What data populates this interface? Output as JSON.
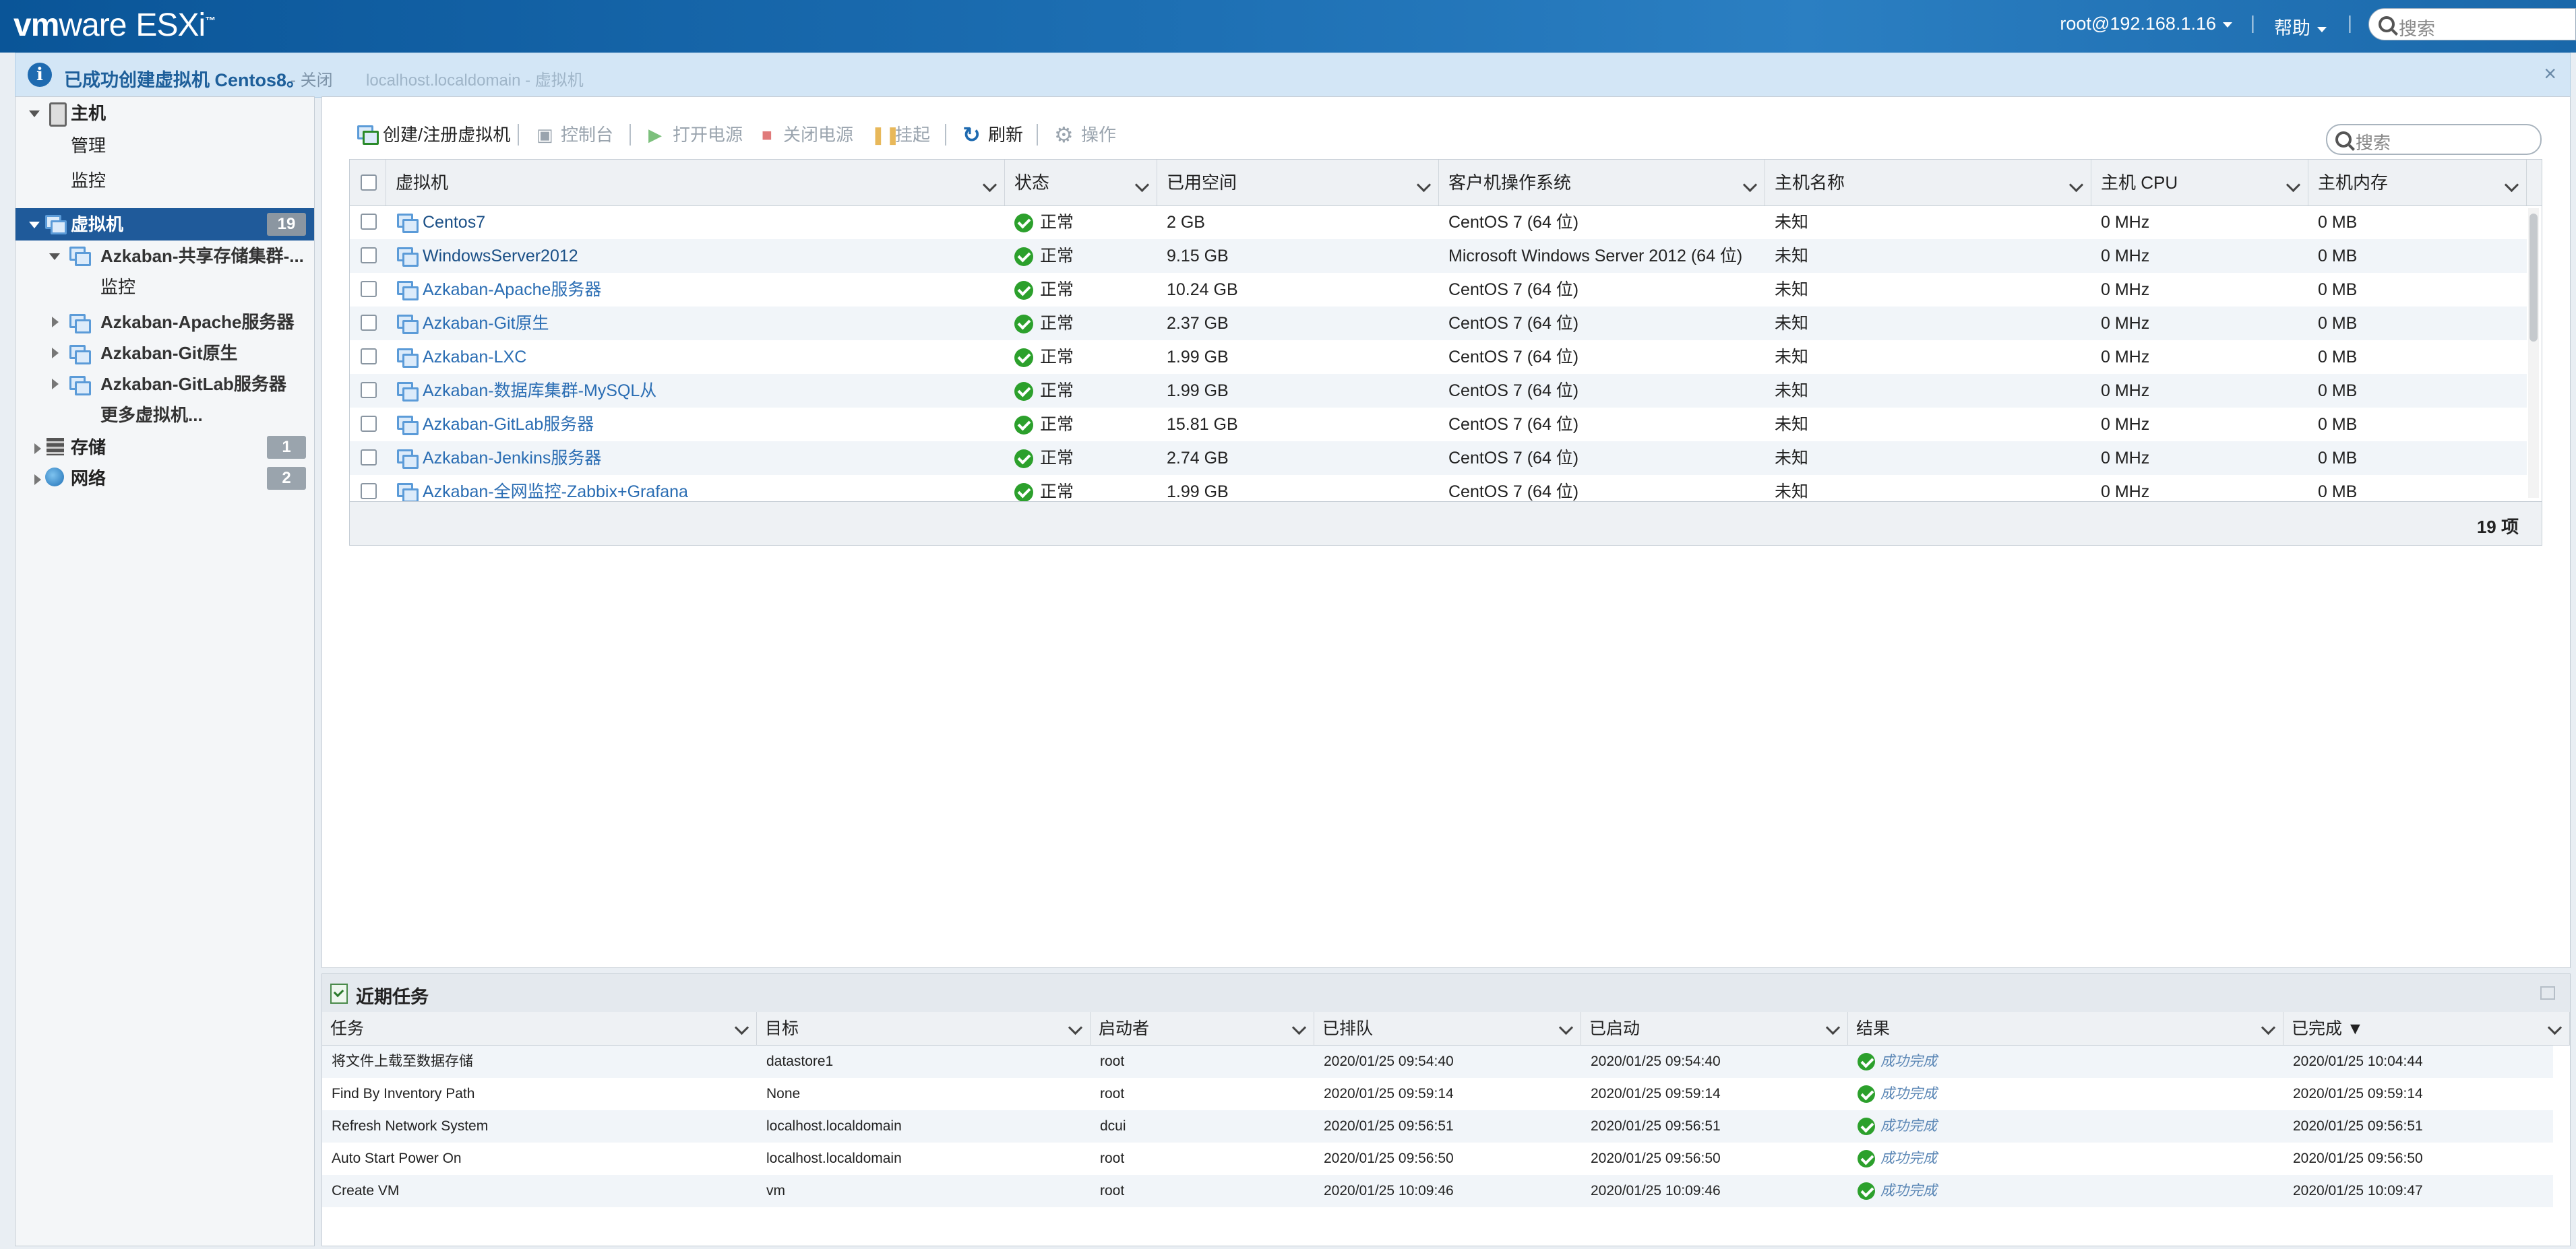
{
  "header": {
    "brand_vm": "vm",
    "brand_ware": "ware",
    "brand_esxi": "ESXi",
    "user": "root@192.168.1.16",
    "help": "帮助",
    "search_placeholder": "搜索"
  },
  "notification": {
    "message": "已成功创建虚拟机 Centos8。",
    "close": "- 关闭",
    "breadcrumb_ghost": "localhost.localdomain - 虚拟机"
  },
  "navigator": {
    "host": "主机",
    "host_manage": "管理",
    "host_monitor": "监控",
    "vms": "虚拟机",
    "vms_count": "19",
    "vm_items": [
      {
        "label": "Azkaban-共享存储集群-..."
      },
      {
        "label": "监控"
      },
      {
        "label": "Azkaban-Apache服务器"
      },
      {
        "label": "Azkaban-Git原生"
      },
      {
        "label": "Azkaban-GitLab服务器"
      },
      {
        "label": "更多虚拟机..."
      }
    ],
    "storage": "存储",
    "storage_count": "1",
    "network": "网络",
    "network_count": "2"
  },
  "toolbar": {
    "create": "创建/注册虚拟机",
    "console": "控制台",
    "power_on": "打开电源",
    "power_off": "关闭电源",
    "suspend": "挂起",
    "refresh": "刷新",
    "actions": "操作",
    "search_placeholder": "搜索"
  },
  "vm_table": {
    "columns": [
      "虚拟机",
      "状态",
      "已用空间",
      "客户机操作系统",
      "主机名称",
      "主机 CPU",
      "主机内存"
    ],
    "rows": [
      {
        "name": "Centos7",
        "status": "正常",
        "space": "2 GB",
        "os": "CentOS 7 (64 位)",
        "hostname": "未知",
        "cpu": "0 MHz",
        "mem": "0 MB"
      },
      {
        "name": "WindowsServer2012",
        "status": "正常",
        "space": "9.15 GB",
        "os": "Microsoft Windows Server 2012 (64 位)",
        "hostname": "未知",
        "cpu": "0 MHz",
        "mem": "0 MB"
      },
      {
        "name": "Azkaban-Apache服务器",
        "status": "正常",
        "space": "10.24 GB",
        "os": "CentOS 7 (64 位)",
        "hostname": "未知",
        "cpu": "0 MHz",
        "mem": "0 MB"
      },
      {
        "name": "Azkaban-Git原生",
        "status": "正常",
        "space": "2.37 GB",
        "os": "CentOS 7 (64 位)",
        "hostname": "未知",
        "cpu": "0 MHz",
        "mem": "0 MB"
      },
      {
        "name": "Azkaban-LXC",
        "status": "正常",
        "space": "1.99 GB",
        "os": "CentOS 7 (64 位)",
        "hostname": "未知",
        "cpu": "0 MHz",
        "mem": "0 MB"
      },
      {
        "name": "Azkaban-数据库集群-MySQL从",
        "status": "正常",
        "space": "1.99 GB",
        "os": "CentOS 7 (64 位)",
        "hostname": "未知",
        "cpu": "0 MHz",
        "mem": "0 MB"
      },
      {
        "name": "Azkaban-GitLab服务器",
        "status": "正常",
        "space": "15.81 GB",
        "os": "CentOS 7 (64 位)",
        "hostname": "未知",
        "cpu": "0 MHz",
        "mem": "0 MB"
      },
      {
        "name": "Azkaban-Jenkins服务器",
        "status": "正常",
        "space": "2.74 GB",
        "os": "CentOS 7 (64 位)",
        "hostname": "未知",
        "cpu": "0 MHz",
        "mem": "0 MB"
      },
      {
        "name": "Azkaban-全网监控-Zabbix+Grafana",
        "status": "正常",
        "space": "1.99 GB",
        "os": "CentOS 7 (64 位)",
        "hostname": "未知",
        "cpu": "0 MHz",
        "mem": "0 MB"
      }
    ],
    "item_count": "19 项"
  },
  "tasks": {
    "title": "近期任务",
    "columns": [
      "任务",
      "目标",
      "启动者",
      "已排队",
      "已启动",
      "结果",
      "已完成 ▼"
    ],
    "rows": [
      {
        "task": "将文件上载至数据存储",
        "target": "datastore1",
        "initiator": "root",
        "queued": "2020/01/25 09:54:40",
        "started": "2020/01/25 09:54:40",
        "result": "成功完成",
        "completed": "2020/01/25 10:04:44"
      },
      {
        "task": "Find By Inventory Path",
        "target": "None",
        "initiator": "root",
        "queued": "2020/01/25 09:59:14",
        "started": "2020/01/25 09:59:14",
        "result": "成功完成",
        "completed": "2020/01/25 09:59:14"
      },
      {
        "task": "Refresh Network System",
        "target": "localhost.localdomain",
        "initiator": "dcui",
        "queued": "2020/01/25 09:56:51",
        "started": "2020/01/25 09:56:51",
        "result": "成功完成",
        "completed": "2020/01/25 09:56:51"
      },
      {
        "task": "Auto Start Power On",
        "target": "localhost.localdomain",
        "initiator": "root",
        "queued": "2020/01/25 09:56:50",
        "started": "2020/01/25 09:56:50",
        "result": "成功完成",
        "completed": "2020/01/25 09:56:50"
      },
      {
        "task": "Create VM",
        "target": "vm",
        "initiator": "root",
        "queued": "2020/01/25 10:09:46",
        "started": "2020/01/25 10:09:46",
        "result": "成功完成",
        "completed": "2020/01/25 10:09:47"
      }
    ]
  },
  "colors": {
    "header_blue": "#1d6fb3",
    "selected_nav": "#1f5a9a",
    "link_blue": "#2a6db3",
    "ok_green": "#2ca02c"
  }
}
